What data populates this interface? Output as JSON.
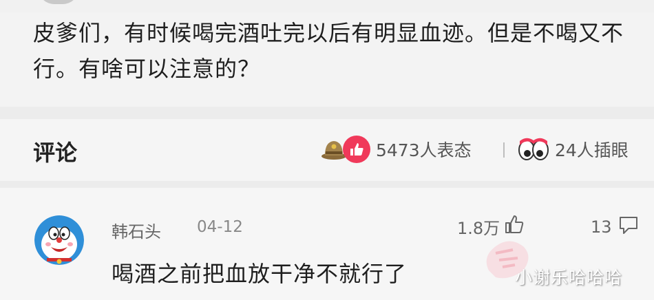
{
  "post": {
    "text": "皮爹们，有时候喝完酒吐完以后有明显血迹。但是不喝又不行。有啥可以注意的？"
  },
  "action_bar": {
    "comment_title": "评论",
    "reactions": [
      {
        "icon": "thumbs-up-icon",
        "count_text": "5473人表态"
      },
      {
        "icon": "eyes-icon",
        "count_text": "24人插眼"
      }
    ]
  },
  "comment": {
    "username": "韩石头",
    "date": "04-12",
    "likes": "1.8万",
    "replies": "13",
    "text": "喝酒之前把血放干净不就行了"
  },
  "watermark": "小谢乐哈哈哈",
  "colors": {
    "like_accent": "#f0395a",
    "text": "#1e1e1e",
    "muted": "#666666"
  }
}
